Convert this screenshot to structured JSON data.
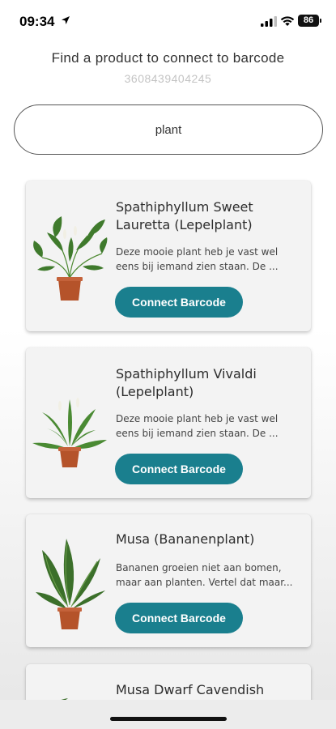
{
  "status_bar": {
    "time": "09:34",
    "battery": "86"
  },
  "header": {
    "title": "Find a product to connect to barcode",
    "barcode": "3608439404245"
  },
  "search": {
    "value": "plant"
  },
  "products": [
    {
      "title": "Spathiphyllum Sweet Lauretta (Lepelplant)",
      "description": "Deze mooie plant heb je vast wel eens bij iemand zien staan. De ...",
      "button": "Connect Barcode"
    },
    {
      "title": "Spathiphyllum Vivaldi (Lepelplant)",
      "description": "Deze mooie plant heb je vast wel eens bij iemand zien staan. De ...",
      "button": "Connect Barcode"
    },
    {
      "title": "Musa (Bananenplant)",
      "description": "Bananen groeien niet aan bomen, maar aan planten. Vertel dat maar...",
      "button": "Connect Barcode"
    },
    {
      "title": "Musa Dwarf Cavendish"
    }
  ],
  "colors": {
    "accent": "#1a7f8e",
    "card_bg": "#f3f3f3",
    "pot": "#b5532a",
    "leaf": "#3f7a2c"
  }
}
